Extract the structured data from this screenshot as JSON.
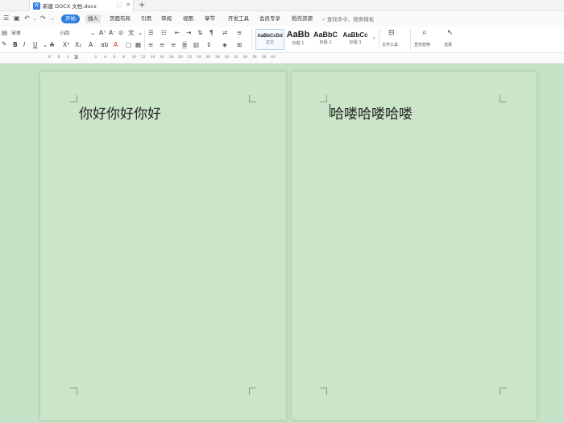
{
  "titlebar": {
    "doc_icon": "W",
    "doc_title": "新建 DOCX 文档.docx",
    "restore_glyph": "⬚",
    "close_glyph": "✕",
    "new_tab_glyph": "+"
  },
  "quick_access": {
    "file_icon": "file-menu-icon",
    "save_icon": "save-icon",
    "undo_icon": "undo-icon",
    "redo_icon": "redo-icon"
  },
  "menu": {
    "items": [
      "开始",
      "插入",
      "页面布局",
      "引用",
      "审阅",
      "视图",
      "章节",
      "开发工具",
      "会员专享",
      "稻壳资源"
    ],
    "active": "开始",
    "search_text": "查找命令、搜索模板"
  },
  "ribbon": {
    "font_name": "宋体",
    "font_size": "小四",
    "styles": [
      {
        "sample": "AaBbCcDd",
        "name": "正文"
      },
      {
        "sample": "AaBb",
        "name": "标题 1"
      },
      {
        "sample": "AaBbC",
        "name": "标题 2"
      },
      {
        "sample": "AaBbCc",
        "name": "标题 3"
      }
    ],
    "text_tools_label": "文字工具",
    "find_replace_label": "查找替换",
    "select_label": "选择"
  },
  "ruler": {
    "numbers": [
      "8",
      "6",
      "4",
      "2",
      "",
      "2",
      "4",
      "6",
      "8",
      "10",
      "12",
      "14",
      "16",
      "18",
      "20",
      "22",
      "24",
      "26",
      "28",
      "30",
      "32",
      "34",
      "36",
      "38",
      "40"
    ]
  },
  "pages": [
    {
      "text": "你好你好你好"
    },
    {
      "text": "哈喽哈喽哈喽"
    }
  ],
  "colors": {
    "accent": "#2f7de1",
    "page_bg": "#cbe5c9",
    "canvas_bg": "#c6e2c6"
  }
}
